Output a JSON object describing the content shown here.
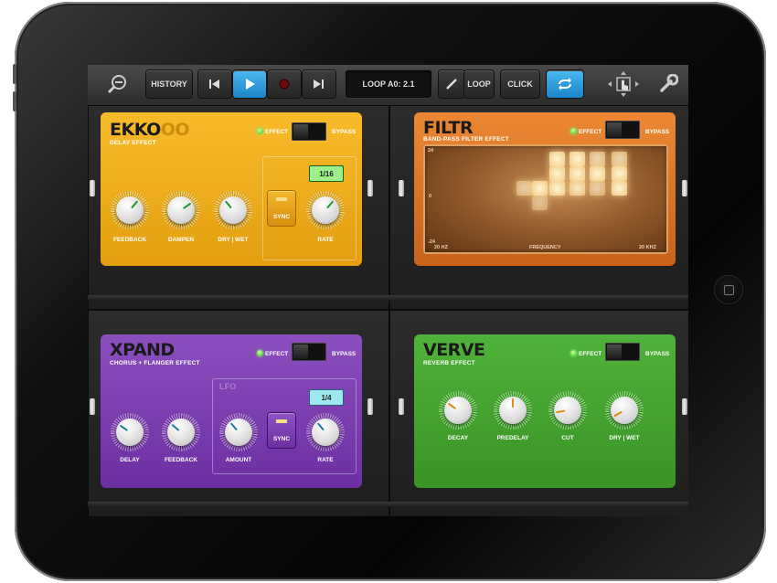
{
  "toolbar": {
    "history_label": "HISTORY",
    "loop_display": "LOOP A0: 2.1",
    "loop_label": "LOOP",
    "click_label": "CLICK"
  },
  "ekko": {
    "title_main": "EKKO",
    "title_faded": "OO",
    "subtitle": "DELAY EFFECT",
    "effect_label": "EFFECT",
    "bypass_label": "BYPASS",
    "display": "1/16",
    "sync_label": "SYNC",
    "knobs": [
      {
        "label": "FEEDBACK",
        "angle": 40
      },
      {
        "label": "DAMPEN",
        "angle": 55
      },
      {
        "label": "DRY | WET",
        "angle": -40
      },
      {
        "label": "RATE",
        "angle": 40
      }
    ]
  },
  "filtr": {
    "title": "FILTR",
    "subtitle": "BAND-PASS FILTER EFFECT",
    "effect_label": "EFFECT",
    "bypass_label": "BYPASS",
    "y_top": "24",
    "y_mid": "0",
    "y_bottom": "-24",
    "x_left": "20 HZ",
    "x_center": "FREQUENCY",
    "x_right": "20 KHZ"
  },
  "xpand": {
    "title": "XPAND",
    "subtitle": "CHORUS + FLANGER EFFECT",
    "effect_label": "EFFECT",
    "bypass_label": "BYPASS",
    "lfo_label": "LFO",
    "display": "1/4",
    "sync_label": "SYNC",
    "knobs": [
      {
        "label": "DELAY",
        "angle": -55
      },
      {
        "label": "FEEDBACK",
        "angle": -50
      },
      {
        "label": "AMOUNT",
        "angle": -40
      },
      {
        "label": "RATE",
        "angle": -40
      }
    ]
  },
  "verve": {
    "title": "VERVE",
    "subtitle": "REVERB EFFECT",
    "effect_label": "EFFECT",
    "bypass_label": "BYPASS",
    "knobs": [
      {
        "label": "DECAY",
        "angle": -55
      },
      {
        "label": "PREDELAY",
        "angle": 0
      },
      {
        "label": "CUT",
        "angle": -100
      },
      {
        "label": "DRY | WET",
        "angle": -120
      }
    ]
  },
  "colors": {
    "ekko_accent": "#1f9a2e",
    "xpand_accent": "#1a7f9a",
    "verve_accent": "#e38a10",
    "play_active": "#2a9ddd"
  }
}
